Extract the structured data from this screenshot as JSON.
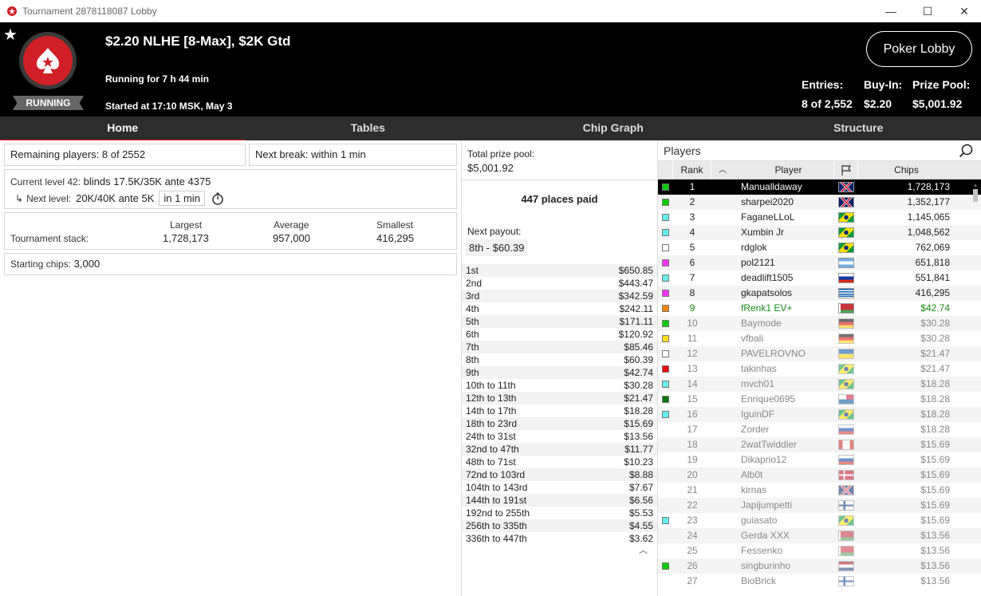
{
  "window": {
    "title": "Tournament 2878118087 Lobby",
    "minimize": "—",
    "maximize": "☐",
    "close": "✕"
  },
  "header": {
    "status": "RUNNING",
    "name": "$2.20 NLHE [8-Max], $2K Gtd",
    "running": "Running for 7 h 44 min",
    "started": "Started at 17:10 MSK, May 3",
    "lobby_button": "Poker Lobby",
    "entries_label": "Entries:",
    "entries": "8 of 2,552",
    "buyin_label": "Buy-In:",
    "buyin": "$2.20",
    "prize_label": "Prize Pool:",
    "prize": "$5,001.92"
  },
  "tabs": [
    "Home",
    "Tables",
    "Chip Graph",
    "Structure"
  ],
  "home": {
    "remaining": "Remaining players: 8 of 2552",
    "next_break_label": "Next break:",
    "next_break": "within 1 min",
    "level_label": "Current level 42:",
    "level": "blinds 17.5K/35K ante 4375",
    "next_level_label": "Next level:",
    "next_level": "20K/40K ante 5K",
    "next_level_time": "in 1 min",
    "stack_label": "Tournament stack:",
    "largest_label": "Largest",
    "largest": "1,728,173",
    "average_label": "Average",
    "average": "957,000",
    "smallest_label": "Smallest",
    "smallest": "416,295",
    "starting_label": "Starting chips:",
    "starting": "3,000"
  },
  "payouts": {
    "total_label": "Total prize pool:",
    "total": "$5,001.92",
    "places_paid": "447 places paid",
    "next_label": "Next payout:",
    "next": "8th - $60.39",
    "rows": [
      [
        "1st",
        "$650.85"
      ],
      [
        "2nd",
        "$443.47"
      ],
      [
        "3rd",
        "$342.59"
      ],
      [
        "4th",
        "$242.11"
      ],
      [
        "5th",
        "$171.11"
      ],
      [
        "6th",
        "$120.92"
      ],
      [
        "7th",
        "$85.46"
      ],
      [
        "8th",
        "$60.39"
      ],
      [
        "9th",
        "$42.74"
      ],
      [
        "10th to 11th",
        "$30.28"
      ],
      [
        "12th to 13th",
        "$21.47"
      ],
      [
        "14th to 17th",
        "$18.28"
      ],
      [
        "18th to 23rd",
        "$15.69"
      ],
      [
        "24th to 31st",
        "$13.56"
      ],
      [
        "32nd to 47th",
        "$11.77"
      ],
      [
        "48th to 71st",
        "$10.23"
      ],
      [
        "72nd to 103rd",
        "$8.88"
      ],
      [
        "104th to 143rd",
        "$7.67"
      ],
      [
        "144th to 191st",
        "$6.56"
      ],
      [
        "192nd to 255th",
        "$5.53"
      ],
      [
        "256th to 335th",
        "$4.55"
      ],
      [
        "336th to 447th",
        "$3.62"
      ]
    ]
  },
  "players": {
    "title": "Players",
    "col_rank": "Rank",
    "col_player": "Player",
    "col_chips": "Chips",
    "rows": [
      {
        "box": "#00cc00",
        "rank": "1",
        "name": "Manualldaway",
        "flag": "uk",
        "chips": "1,728,173",
        "state": "sel"
      },
      {
        "box": "#00cc00",
        "rank": "2",
        "name": "sharpei2020",
        "flag": "uk",
        "chips": "1,352,177",
        "state": ""
      },
      {
        "box": "#66eeee",
        "rank": "3",
        "name": "FaganeLLoL",
        "flag": "br",
        "chips": "1,145,065",
        "state": ""
      },
      {
        "box": "#66eeee",
        "rank": "4",
        "name": "Xumbin Jr",
        "flag": "br",
        "chips": "1,048,562",
        "state": ""
      },
      {
        "box": "#ffffff",
        "rank": "5",
        "name": "rdglok",
        "flag": "br",
        "chips": "762,069",
        "state": ""
      },
      {
        "box": "#ff33ff",
        "rank": "6",
        "name": "pol2121",
        "flag": "ar",
        "chips": "651,818",
        "state": ""
      },
      {
        "box": "#66eeee",
        "rank": "7",
        "name": "deadlift1505",
        "flag": "ru",
        "chips": "551,841",
        "state": ""
      },
      {
        "box": "#ff33ff",
        "rank": "8",
        "name": "gkapatsolos",
        "flag": "gr",
        "chips": "416,295",
        "state": ""
      },
      {
        "box": "#ff8800",
        "rank": "9",
        "name": "fRenk1 EV+",
        "flag": "by",
        "chips": "$42.74",
        "state": "green"
      },
      {
        "box": "#00cc00",
        "rank": "10",
        "name": "Baymode",
        "flag": "de",
        "chips": "$30.28",
        "state": "dim"
      },
      {
        "box": "#ffdd22",
        "rank": "11",
        "name": "vfbali",
        "flag": "de",
        "chips": "$30.28",
        "state": "dim"
      },
      {
        "box": "#ffffff",
        "rank": "12",
        "name": "PAVELROVNO",
        "flag": "ua",
        "chips": "$21.47",
        "state": "dim"
      },
      {
        "box": "#ee0000",
        "rank": "13",
        "name": "takinhas",
        "flag": "br",
        "chips": "$21.47",
        "state": "dim"
      },
      {
        "box": "#66eeee",
        "rank": "14",
        "name": "mvch01",
        "flag": "br",
        "chips": "$18.28",
        "state": "dim"
      },
      {
        "box": "#007700",
        "rank": "15",
        "name": "Enrique0695",
        "flag": "pa",
        "chips": "$18.28",
        "state": "dim"
      },
      {
        "box": "#66eeee",
        "rank": "16",
        "name": "IguinDF",
        "flag": "br",
        "chips": "$18.28",
        "state": "dim"
      },
      {
        "box": "",
        "rank": "17",
        "name": "Zorder",
        "flag": "ru",
        "chips": "$18.28",
        "state": "dim"
      },
      {
        "box": "",
        "rank": "18",
        "name": "2watTwiddler",
        "flag": "ca",
        "chips": "$15.69",
        "state": "dim"
      },
      {
        "box": "",
        "rank": "19",
        "name": "Dikaprio12",
        "flag": "ru",
        "chips": "$15.69",
        "state": "dim"
      },
      {
        "box": "",
        "rank": "20",
        "name": "Alb0t",
        "flag": "dk",
        "chips": "$15.69",
        "state": "dim"
      },
      {
        "box": "",
        "rank": "21",
        "name": "kirnas",
        "flag": "uk",
        "chips": "$15.69",
        "state": "dim"
      },
      {
        "box": "",
        "rank": "22",
        "name": "Japijumpetti",
        "flag": "fi",
        "chips": "$15.69",
        "state": "dim"
      },
      {
        "box": "#66eeee",
        "rank": "23",
        "name": "guiasato",
        "flag": "br",
        "chips": "$15.69",
        "state": "dim"
      },
      {
        "box": "",
        "rank": "24",
        "name": "Gerda XXX",
        "flag": "by",
        "chips": "$13.56",
        "state": "dim"
      },
      {
        "box": "",
        "rank": "25",
        "name": "Fessenko",
        "flag": "by",
        "chips": "$13.56",
        "state": "dim"
      },
      {
        "box": "#00cc00",
        "rank": "26",
        "name": "singburinho",
        "flag": "nl",
        "chips": "$13.56",
        "state": "dim"
      },
      {
        "box": "",
        "rank": "27",
        "name": "BioBrick",
        "flag": "fi",
        "chips": "$13.56",
        "state": "dim"
      }
    ]
  },
  "colors": {
    "brand_red": "#d01f26",
    "header_bg": "#000000",
    "tabs_bg": "#2d2d2d"
  }
}
